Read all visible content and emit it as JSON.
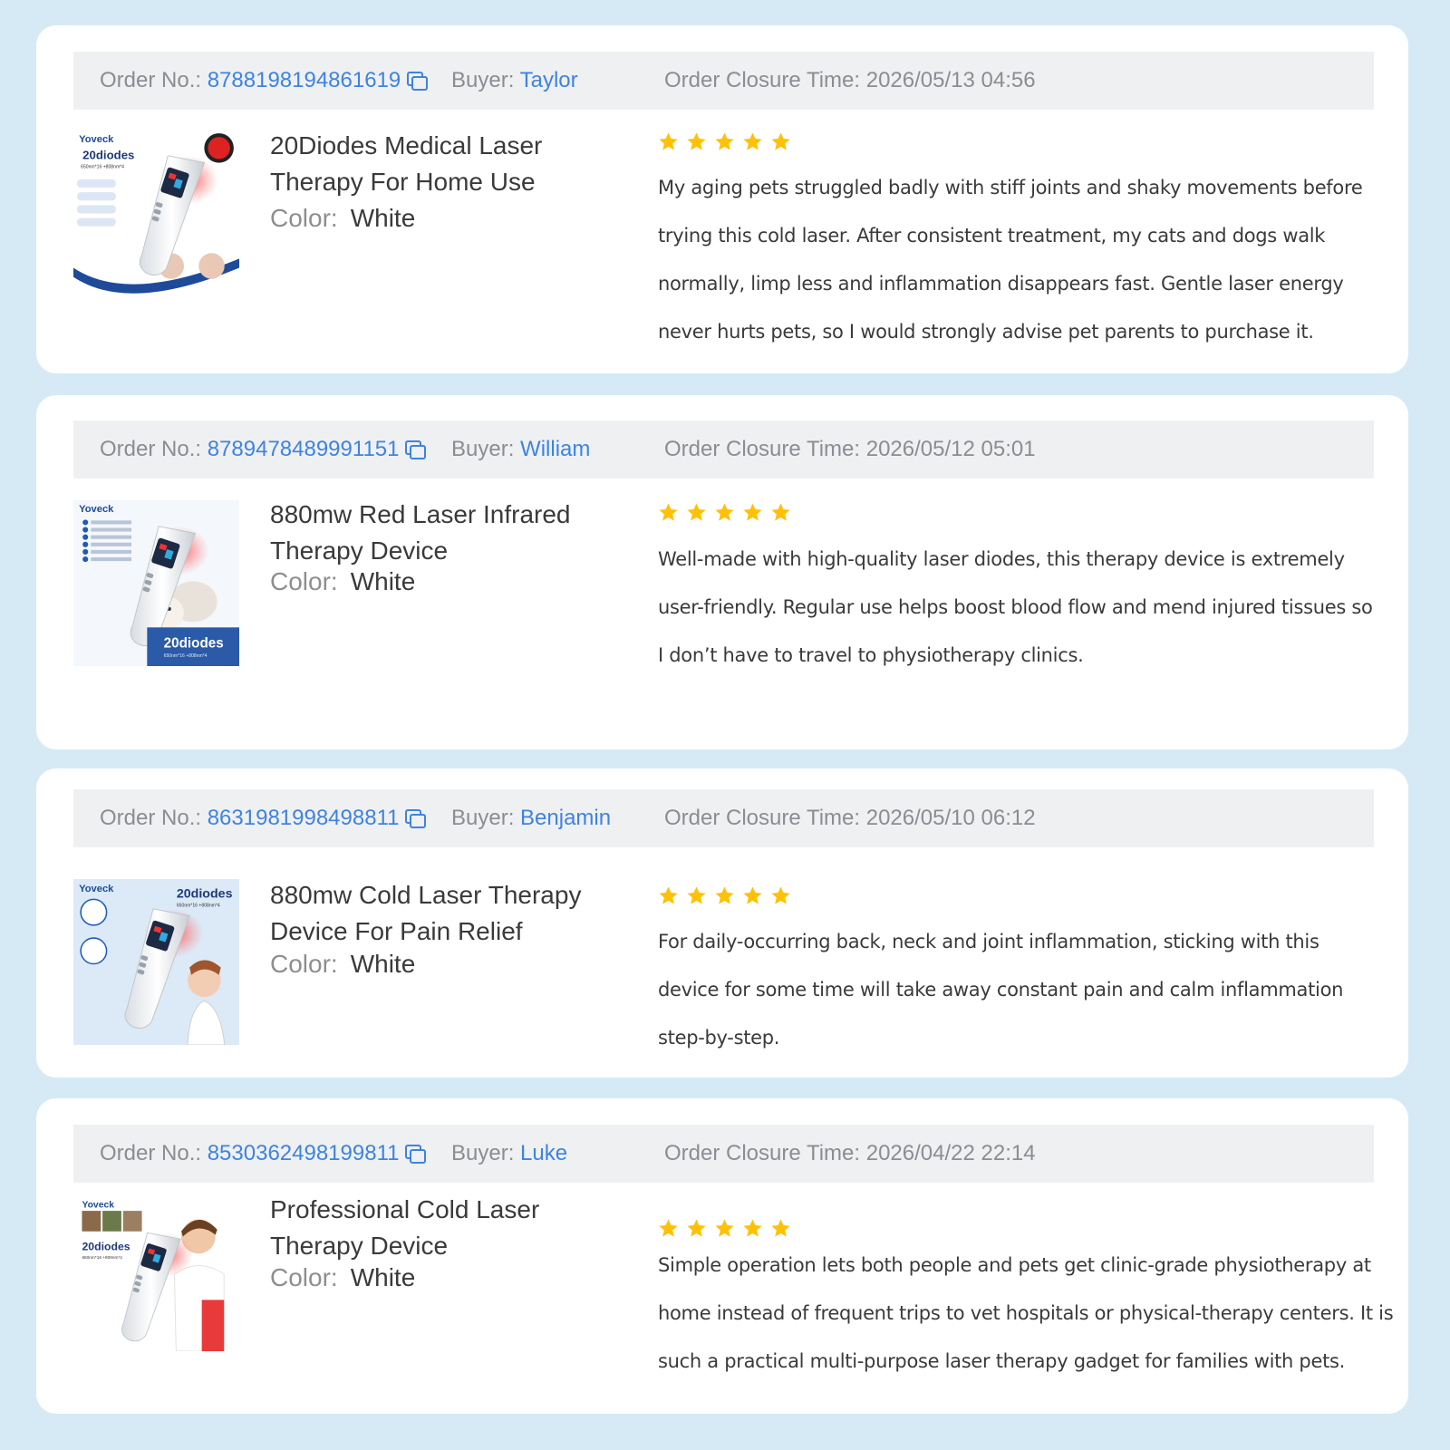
{
  "labels": {
    "order_no": "Order No.:",
    "buyer": "Buyer:",
    "closure": "Order Closure Time:",
    "color": "Color:"
  },
  "icons": {
    "copy": "copy-icon",
    "star": "star-icon"
  },
  "colors": {
    "link": "#3e83e0",
    "star": "#ffc107",
    "page_bg": "#d6eaf6"
  },
  "orders": [
    {
      "order_no": "8788198194861619",
      "buyer": "Taylor",
      "closure_time": "2026/05/13 04:56",
      "product_title": "20Diodes Medical Laser Therapy For Home Use",
      "color": "White",
      "rating": 5,
      "review": "My aging pets struggled badly with stiff joints and shaky movements before trying this cold laser. After consistent treatment, my cats and dogs walk normally, limp less and inflammation disappears fast. Gentle laser energy never hurts pets, so I would strongly advise pet parents to purchase it.",
      "thumb": {
        "brand": "Yoveck",
        "badge": "20diodes",
        "spec": "650nm*16 +808nm*4"
      }
    },
    {
      "order_no": "8789478489991151",
      "buyer": "William",
      "closure_time": "2026/05/12 05:01",
      "product_title": "880mw Red Laser Infrared Therapy Device",
      "color": "White",
      "rating": 5,
      "review": "Well-made with high-quality laser diodes, this therapy device is extremely user-friendly. Regular use helps boost blood flow and mend injured tissues so I don’t have to travel to physiotherapy clinics.",
      "thumb": {
        "brand": "Yoveck",
        "badge": "20diodes",
        "spec": "650nm*16 +808nm*4"
      }
    },
    {
      "order_no": "8631981998498811",
      "buyer": "Benjamin",
      "closure_time": "2026/05/10 06:12",
      "product_title": "880mw Cold Laser Therapy Device For Pain Relief",
      "color": "White",
      "rating": 5,
      "review": "For daily-occurring back, neck and joint inflammation, sticking with this device for some time will take away constant pain and calm inflammation step-by-step.",
      "thumb": {
        "brand": "Yoveck",
        "badge": "20diodes",
        "spec": "650nm*16 +808nm*4"
      }
    },
    {
      "order_no": "8530362498199811",
      "buyer": "Luke",
      "closure_time": "2026/04/22 22:14",
      "product_title": "Professional Cold Laser Therapy Device",
      "color": "White",
      "rating": 5,
      "review": "Simple operation lets both people and pets get clinic-grade physiotherapy at home instead of frequent trips to vet hospitals or physical-therapy centers. It is such a practical multi-purpose laser therapy gadget for families with pets.",
      "thumb": {
        "brand": "Yoveck",
        "badge": "20diodes",
        "spec": "650nm*16 +808nm*4"
      }
    }
  ]
}
